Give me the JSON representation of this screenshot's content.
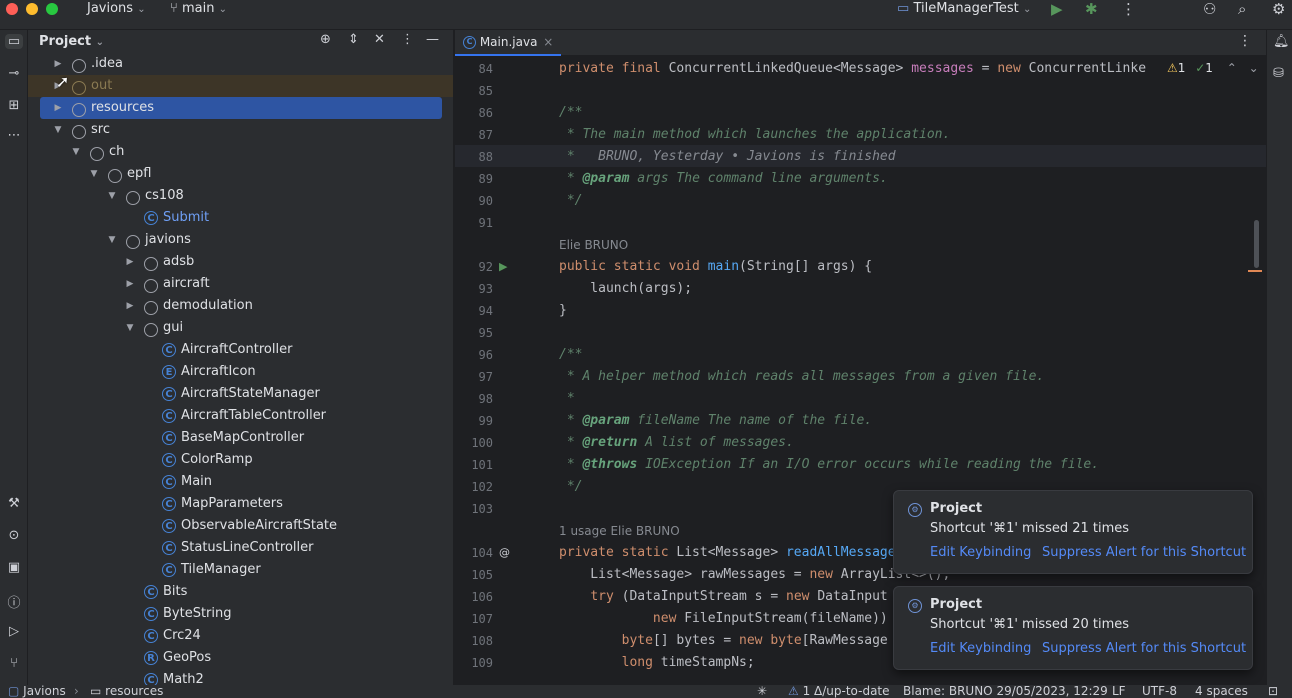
{
  "titlebar": {
    "project": "Javions",
    "branch": "main",
    "run_config": "TileManagerTest"
  },
  "project_panel": {
    "title": "Project",
    "tree": [
      {
        "label": ".idea",
        "depth": 0,
        "type": "folder",
        "arrow": "closed"
      },
      {
        "label": "out",
        "depth": 0,
        "type": "folder",
        "arrow": "closed",
        "excluded": true
      },
      {
        "label": "resources",
        "depth": 0,
        "type": "folder",
        "arrow": "closed",
        "selected": true
      },
      {
        "label": "src",
        "depth": 0,
        "type": "folder",
        "arrow": "open"
      },
      {
        "label": "ch",
        "depth": 1,
        "type": "folder",
        "arrow": "open"
      },
      {
        "label": "epfl",
        "depth": 2,
        "type": "folder",
        "arrow": "open"
      },
      {
        "label": "cs108",
        "depth": 3,
        "type": "folder",
        "arrow": "open"
      },
      {
        "label": "Submit",
        "depth": 4,
        "type": "class",
        "arrow": "none",
        "link": true
      },
      {
        "label": "javions",
        "depth": 3,
        "type": "folder",
        "arrow": "open"
      },
      {
        "label": "adsb",
        "depth": 4,
        "type": "folder",
        "arrow": "closed"
      },
      {
        "label": "aircraft",
        "depth": 4,
        "type": "folder",
        "arrow": "closed"
      },
      {
        "label": "demodulation",
        "depth": 4,
        "type": "folder",
        "arrow": "closed"
      },
      {
        "label": "gui",
        "depth": 4,
        "type": "folder",
        "arrow": "open"
      },
      {
        "label": "AircraftController",
        "depth": 5,
        "type": "class",
        "arrow": "none"
      },
      {
        "label": "AircraftIcon",
        "depth": 5,
        "type": "enum",
        "arrow": "none"
      },
      {
        "label": "AircraftStateManager",
        "depth": 5,
        "type": "class",
        "arrow": "none"
      },
      {
        "label": "AircraftTableController",
        "depth": 5,
        "type": "class",
        "arrow": "none"
      },
      {
        "label": "BaseMapController",
        "depth": 5,
        "type": "class",
        "arrow": "none"
      },
      {
        "label": "ColorRamp",
        "depth": 5,
        "type": "class",
        "arrow": "none"
      },
      {
        "label": "Main",
        "depth": 5,
        "type": "class",
        "arrow": "none"
      },
      {
        "label": "MapParameters",
        "depth": 5,
        "type": "class",
        "arrow": "none"
      },
      {
        "label": "ObservableAircraftState",
        "depth": 5,
        "type": "class",
        "arrow": "none"
      },
      {
        "label": "StatusLineController",
        "depth": 5,
        "type": "class",
        "arrow": "none"
      },
      {
        "label": "TileManager",
        "depth": 5,
        "type": "class",
        "arrow": "none"
      },
      {
        "label": "Bits",
        "depth": 4,
        "type": "class",
        "arrow": "none"
      },
      {
        "label": "ByteString",
        "depth": 4,
        "type": "class",
        "arrow": "none"
      },
      {
        "label": "Crc24",
        "depth": 4,
        "type": "class",
        "arrow": "none"
      },
      {
        "label": "GeoPos",
        "depth": 4,
        "type": "record",
        "arrow": "none"
      },
      {
        "label": "Math2",
        "depth": 4,
        "type": "class",
        "arrow": "none"
      }
    ]
  },
  "editor": {
    "tab": "Main.java",
    "inspection": {
      "warnings": "1",
      "ok": "1"
    },
    "lines": [
      {
        "n": "84",
        "html": "<span class='kw'>private final </span>ConcurrentLinkedQueue&lt;Message&gt; <span class='fld'>messages</span> = <span class='kw'>new </span>ConcurrentLinke"
      },
      {
        "n": "85",
        "html": ""
      },
      {
        "n": "86",
        "html": "<span class='doc'>/**</span>"
      },
      {
        "n": "87",
        "html": "<span class='doc'> * The main method which launches the application.</span>"
      },
      {
        "n": "88",
        "html": "<span class='doc'> *   </span><span style='color:#868a91;font-style:italic'>BRUNO, Yesterday • Javions is finished</span>"
      },
      {
        "n": "89",
        "html": "<span class='doc'> * </span><span class='tag'>@param </span><span class='par'>args </span><span class='doc'>The command line arguments.</span>"
      },
      {
        "n": "90",
        "html": "<span class='doc'> */</span>"
      },
      {
        "n": "91",
        "html": ""
      },
      {
        "n": "",
        "hint": "Elie BRUNO"
      },
      {
        "n": "92",
        "html": "<span class='kw'>public static void </span><span class='fn'>main</span>(String[] args) {",
        "run": true
      },
      {
        "n": "93",
        "html": "    launch(args);"
      },
      {
        "n": "94",
        "html": "}"
      },
      {
        "n": "95",
        "html": ""
      },
      {
        "n": "96",
        "html": "<span class='doc'>/**</span>"
      },
      {
        "n": "97",
        "html": "<span class='doc'> * A helper method which reads all messages from a given file.</span>"
      },
      {
        "n": "98",
        "html": "<span class='doc'> *</span>"
      },
      {
        "n": "99",
        "html": "<span class='doc'> * </span><span class='tag'>@param </span><span class='par'>fileName </span><span class='doc'>The name of the file.</span>"
      },
      {
        "n": "100",
        "html": "<span class='doc'> * </span><span class='tag'>@return </span><span class='doc'>A list of messages.</span>"
      },
      {
        "n": "101",
        "html": "<span class='doc'> * </span><span class='tag'>@throws </span><span class='par'>IOException </span><span class='doc'>If an I/O error occurs while reading the file.</span>"
      },
      {
        "n": "102",
        "html": "<span class='doc'> */</span>"
      },
      {
        "n": "103",
        "html": ""
      },
      {
        "n": "",
        "hint": "1 usage   Elie BRUNO"
      },
      {
        "n": "104",
        "html": "<span class='kw'>private static </span>List&lt;Message&gt; <span class='fn'>readAllMessages</span>",
        "at": true
      },
      {
        "n": "105",
        "html": "    List&lt;Message&gt; rawMessages = <span class='kw'>new </span>ArrayList&lt;&gt;();"
      },
      {
        "n": "106",
        "html": "    <span class='kw'>try </span>(DataInputStream s = <span class='kw'>new </span>DataInput"
      },
      {
        "n": "107",
        "html": "            <span class='kw'>new </span>FileInputStream(fileName))"
      },
      {
        "n": "108",
        "html": "        <span class='kw'>byte</span>[] bytes = <span class='kw'>new byte</span>[RawMessage"
      },
      {
        "n": "109",
        "html": "        <span class='kw'>long </span>timeStampNs;"
      }
    ]
  },
  "notifications": [
    {
      "title": "Project",
      "body": "Shortcut '⌘1' missed 21 times",
      "action1": "Edit Keybinding",
      "action2": "Suppress Alert for this Shortcut"
    },
    {
      "title": "Project",
      "body": "Shortcut '⌘1' missed 20 times",
      "action1": "Edit Keybinding",
      "action2": "Suppress Alert for this Shortcut"
    }
  ],
  "statusbar": {
    "crumb1": "Javions",
    "crumb2": "resources",
    "vcs": "1 Δ/up-to-date",
    "blame": "Blame: BRUNO 29/05/2023, 12:29",
    "line_sep": "LF",
    "encoding": "UTF-8",
    "indent": "4 spaces"
  },
  "colors": {
    "accent": "#3574f0",
    "selection": "#2e55a3",
    "bg": "#1e1f22",
    "panel": "#2b2d30"
  }
}
